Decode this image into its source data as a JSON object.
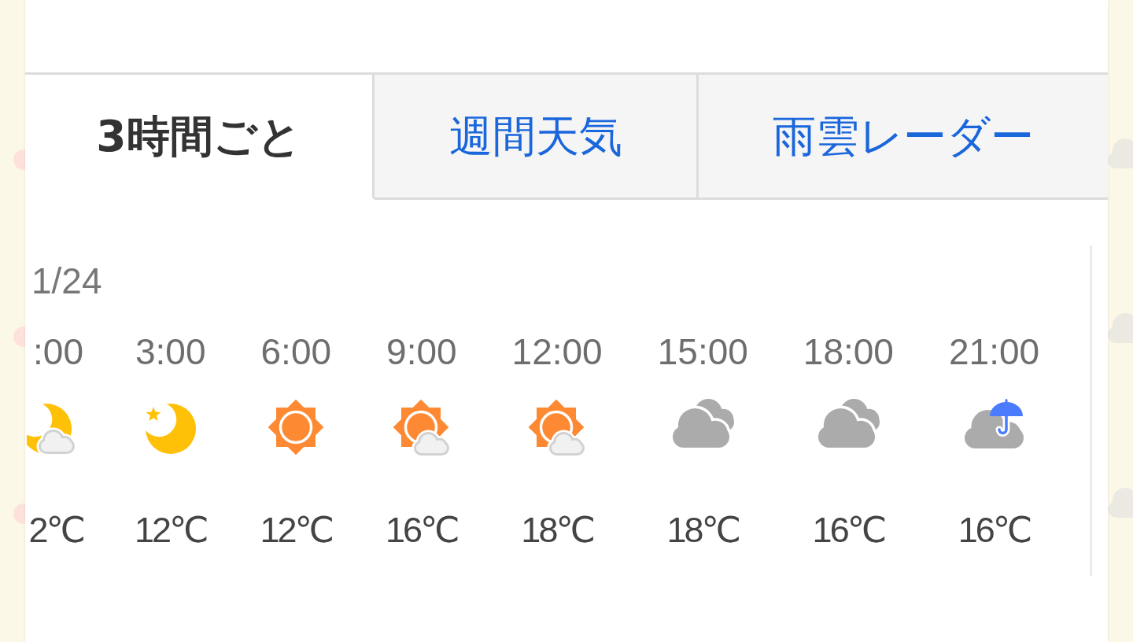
{
  "tabs": [
    {
      "label": "3時間ごと",
      "selected": true
    },
    {
      "label": "週間天気",
      "selected": false
    },
    {
      "label": "雨雲レーダー",
      "selected": false
    }
  ],
  "forecast": {
    "date": "1/24",
    "hours": [
      {
        "time": ":00",
        "kind": "night_partly_cloudy",
        "temperature": "2℃"
      },
      {
        "time": "3:00",
        "kind": "night_clear",
        "temperature": "12℃"
      },
      {
        "time": "6:00",
        "kind": "sunny",
        "temperature": "12℃"
      },
      {
        "time": "9:00",
        "kind": "sunny_partly_cloudy",
        "temperature": "16℃"
      },
      {
        "time": "12:00",
        "kind": "sunny_partly_cloudy",
        "temperature": "18℃"
      },
      {
        "time": "15:00",
        "kind": "cloudy",
        "temperature": "18℃"
      },
      {
        "time": "18:00",
        "kind": "cloudy",
        "temperature": "16℃"
      },
      {
        "time": "21:00",
        "kind": "rain",
        "temperature": "16℃"
      }
    ]
  }
}
